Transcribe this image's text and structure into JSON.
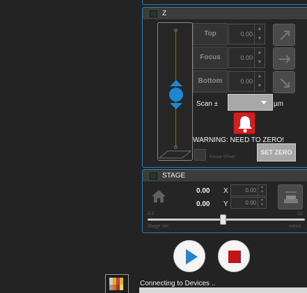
{
  "z_panel": {
    "title": "Z",
    "rows": [
      {
        "label": "Top",
        "value": "0.00"
      },
      {
        "label": "Focus",
        "value": "0.00"
      },
      {
        "label": "Bottom",
        "value": "0.00"
      }
    ],
    "scan_label": "Scan ±",
    "scan_unit": "µm",
    "scan_value": "",
    "warning": "WARNING: NEED TO ZERO!",
    "mouse_wheel_label": "Mouse Wheel",
    "set_zero_label": "SET ZERO"
  },
  "stage_panel": {
    "title": "STAGE",
    "x_read": "0.00",
    "y_read": "0.00",
    "x_axis": "X",
    "y_axis": "Y",
    "x_value": "0.00",
    "y_value": "0.00",
    "vel_min": "0.2",
    "vel_max": "10",
    "vel_label": "Stage Vel",
    "vel_unit": "mm/s",
    "vel_fraction": 0.48
  },
  "status": {
    "text": "Connecting to Devices .."
  },
  "colors": {
    "accent": "#2f7fb0",
    "knob_blue": "#1e86d6",
    "alarm_red": "#d11f1f",
    "stop_red": "#c0161b",
    "play_blue": "#1e86d6"
  }
}
